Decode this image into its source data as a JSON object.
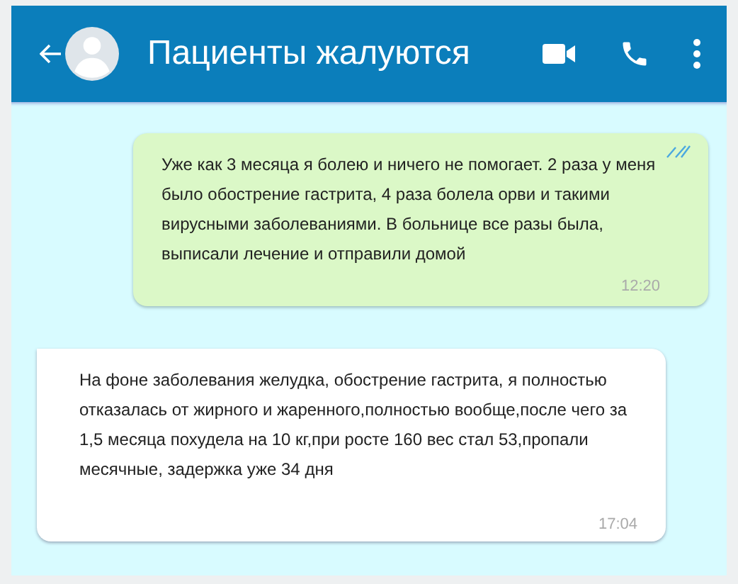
{
  "header": {
    "title": "Пациенты жалуются"
  },
  "messages": [
    {
      "kind": "outgoing",
      "text": "Уже как 3 месяца я болею и ничего не помогает. 2 раза у меня было обострение гастрита, 4 раза болела орви и такими вирусными заболеваниями. В больнице все разы была, выписали лечение и отправили домой",
      "time": "12:20",
      "read": true
    },
    {
      "kind": "incoming",
      "text": "На фоне заболевания желудка, обострение гастрита, я полностью отказалась от жирного и жаренного,полностью вообще,после чего за 1,5 месяца похудела на 10 кг,при росте 160 вес стал 53,пропали месячные, задержка уже 34 дня",
      "time": "17:04"
    }
  ]
}
